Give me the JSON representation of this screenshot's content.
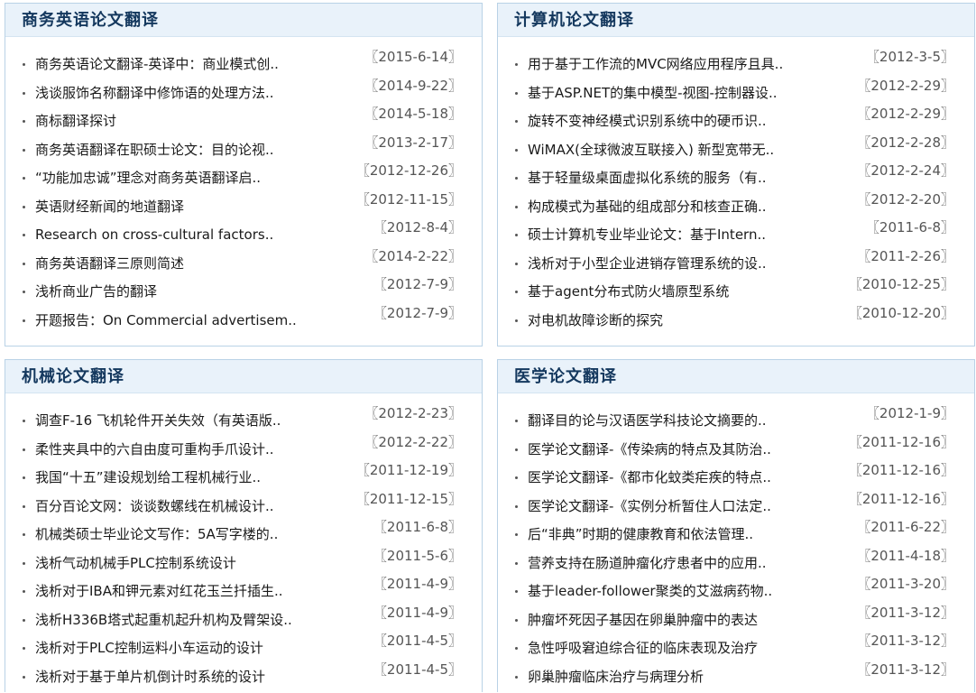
{
  "panels": [
    {
      "title": "商务英语论文翻译",
      "items": [
        {
          "text": "商务英语论文翻译-英译中：商业模式创..",
          "date": "〖2015-6-14〗"
        },
        {
          "text": "浅谈服饰名称翻译中修饰语的处理方法..",
          "date": "〖2014-9-22〗"
        },
        {
          "text": "商标翻译探讨",
          "date": "〖2014-5-18〗"
        },
        {
          "text": "商务英语翻译在职硕士论文：目的论视..",
          "date": "〖2013-2-17〗"
        },
        {
          "text": "“功能加忠诚”理念对商务英语翻译启..",
          "date": "〖2012-12-26〗"
        },
        {
          "text": "英语财经新闻的地道翻译",
          "date": "〖2012-11-15〗"
        },
        {
          "text": "Research on cross-cultural factors..",
          "date": "〖2012-8-4〗"
        },
        {
          "text": "商务英语翻译三原则简述",
          "date": "〖2014-2-22〗"
        },
        {
          "text": "浅析商业广告的翻译",
          "date": "〖2012-7-9〗"
        },
        {
          "text": "开题报告：On Commercial advertisem..",
          "date": "〖2012-7-9〗"
        }
      ]
    },
    {
      "title": "计算机论文翻译",
      "items": [
        {
          "text": "用于基于工作流的MVC网络应用程序且具..",
          "date": "〖2012-3-5〗"
        },
        {
          "text": "基于ASP.NET的集中模型-视图-控制器设..",
          "date": "〖2012-2-29〗"
        },
        {
          "text": "旋转不变神经模式识别系统中的硬币识..",
          "date": "〖2012-2-29〗"
        },
        {
          "text": "WiMAX(全球微波互联接入) 新型宽带无..",
          "date": "〖2012-2-28〗"
        },
        {
          "text": "基于轻量级桌面虚拟化系统的服务（有..",
          "date": "〖2012-2-24〗"
        },
        {
          "text": "构成模式为基础的组成部分和核查正确..",
          "date": "〖2012-2-20〗"
        },
        {
          "text": "硕士计算机专业毕业论文：基于Intern..",
          "date": "〖2011-6-8〗"
        },
        {
          "text": "浅析对于小型企业进销存管理系统的设..",
          "date": "〖2011-2-26〗"
        },
        {
          "text": "基于agent分布式防火墙原型系统",
          "date": "〖2010-12-25〗"
        },
        {
          "text": "对电机故障诊断的探究",
          "date": "〖2010-12-20〗"
        }
      ]
    },
    {
      "title": "机械论文翻译",
      "items": [
        {
          "text": "调查F-16 飞机轮件开关失效（有英语版..",
          "date": "〖2012-2-23〗"
        },
        {
          "text": "柔性夹具中的六自由度可重构手爪设计..",
          "date": "〖2012-2-22〗"
        },
        {
          "text": "我国“十五”建设规划给工程机械行业..",
          "date": "〖2011-12-19〗"
        },
        {
          "text": "百分百论文网：谈谈数螺线在机械设计..",
          "date": "〖2011-12-15〗"
        },
        {
          "text": "机械类硕士毕业论文写作：5A写字楼的..",
          "date": "〖2011-6-8〗"
        },
        {
          "text": "浅析气动机械手PLC控制系统设计",
          "date": "〖2011-5-6〗"
        },
        {
          "text": "浅析对于IBA和钾元素对红花玉兰扦插生..",
          "date": "〖2011-4-9〗"
        },
        {
          "text": "浅析H336B塔式起重机起升机构及臂架设..",
          "date": "〖2011-4-9〗"
        },
        {
          "text": "浅析对于PLC控制运料小车运动的设计",
          "date": "〖2011-4-5〗"
        },
        {
          "text": "浅析对于基于单片机倒计时系统的设计",
          "date": "〖2011-4-5〗"
        }
      ]
    },
    {
      "title": "医学论文翻译",
      "items": [
        {
          "text": "翻译目的论与汉语医学科技论文摘要的..",
          "date": "〖2012-1-9〗"
        },
        {
          "text": "医学论文翻译-《传染病的特点及其防治..",
          "date": "〖2011-12-16〗"
        },
        {
          "text": "医学论文翻译-《都市化蚊类疟疾的特点..",
          "date": "〖2011-12-16〗"
        },
        {
          "text": "医学论文翻译-《实例分析暂住人口法定..",
          "date": "〖2011-12-16〗"
        },
        {
          "text": "后“非典”时期的健康教育和依法管理..",
          "date": "〖2011-6-22〗"
        },
        {
          "text": "营养支持在肠道肿瘤化疗患者中的应用..",
          "date": "〖2011-4-18〗"
        },
        {
          "text": "基于leader-follower聚类的艾滋病药物..",
          "date": "〖2011-3-20〗"
        },
        {
          "text": "肿瘤坏死因子基因在卵巢肿瘤中的表达",
          "date": "〖2011-3-12〗"
        },
        {
          "text": "急性呼吸窘迫综合征的临床表现及治疗",
          "date": "〖2011-3-12〗"
        },
        {
          "text": "卵巢肿瘤临床治疗与病理分析",
          "date": "〖2011-3-12〗"
        }
      ]
    }
  ]
}
